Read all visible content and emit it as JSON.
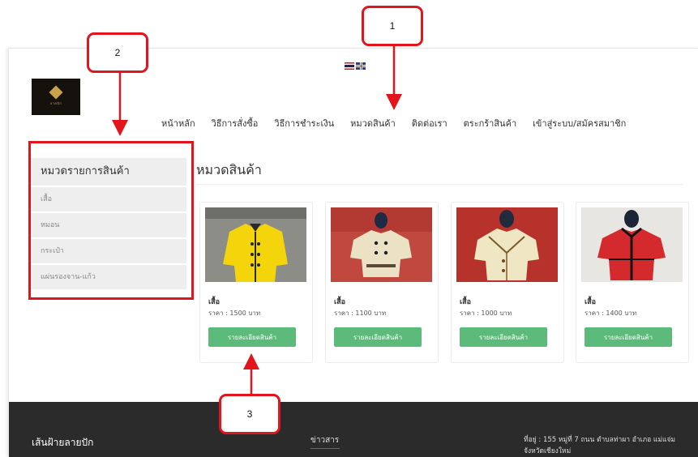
{
  "annotations": {
    "label1": "1",
    "label2": "2",
    "label3": "3"
  },
  "language_flags": [
    "thai-flag-icon",
    "uk-flag-icon"
  ],
  "logo": {
    "text": "ลายปัก"
  },
  "nav": {
    "items": [
      "หน้าหลัก",
      "วิธีการสั่งซื้อ",
      "วิธีการชำระเงิน",
      "หมวดสินค้า",
      "ติดต่อเรา",
      "ตระกร้าสินค้า",
      "เข้าสู่ระบบ/สมัครสมาชิก"
    ]
  },
  "sidebar": {
    "title": "หมวดรายการสินค้า",
    "items": [
      "เสื้อ",
      "หมอน",
      "กระเป๋า",
      "แผ่นรองจาน-แก้ว"
    ]
  },
  "main": {
    "title": "หมวดสินค้า"
  },
  "products": [
    {
      "name": "เสื้อ",
      "price": "ราคา : 1500 บาท",
      "button": "รายละเอียดสินค้า",
      "color": "#f4d40a"
    },
    {
      "name": "เสื้อ",
      "price": "ราคา : 1100 บาท",
      "button": "รายละเอียดสินค้า",
      "color": "#ebe1c5"
    },
    {
      "name": "เสื้อ",
      "price": "ราคา : 1000 บาท",
      "button": "รายละเอียดสินค้า",
      "color": "#efe7c4"
    },
    {
      "name": "เสื้อ",
      "price": "ราคา : 1400 บาท",
      "button": "รายละเอียดสินค้า",
      "color": "#d42a2e"
    }
  ],
  "footer": {
    "brand": "เส้นฝ้ายลายปัก",
    "news": "ข่าวสาร",
    "address": "ที่อยู่ : 155 หมู่ที่ 7 ถนน ตำบลท่าผา อำเภอ แม่แจ่ม จังหวัดเชียงใหม่"
  },
  "colors": {
    "annotation": "#e2141c",
    "button": "#5cbb7a",
    "footer_bg": "#2b2b2b"
  }
}
